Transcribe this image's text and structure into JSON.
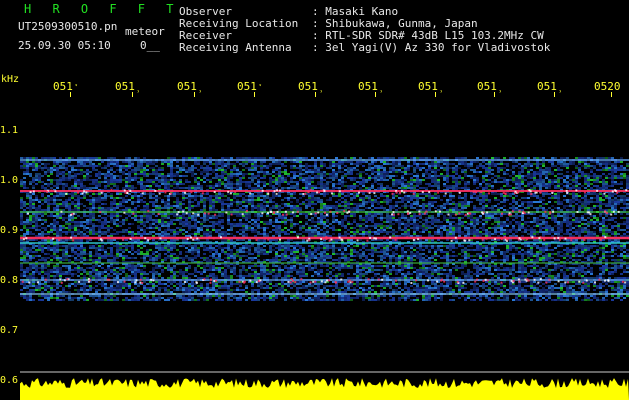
{
  "header": {
    "title": "H R O F F T",
    "filename": "UT2509300510.pn",
    "filename_suffix": "meteor",
    "timestamp": "25.09.30 05:10",
    "status": "0__",
    "info_labels": [
      "Observer",
      "Receiving Location",
      "Receiver",
      "Receiving Antenna"
    ],
    "info_values": [
      ": Masaki Kano",
      ": Shibukawa, Gunma, Japan",
      ": RTL-SDR SDR# 43dB L15 103.2MHz CW",
      ": 3el Yagi(V) Az 330 for Vladivostok"
    ]
  },
  "axis": {
    "y_unit": "kHz",
    "y_ticks": [
      "1.1",
      "1.0",
      "0.9",
      "0.8",
      "0.7",
      "0.6"
    ],
    "x_ticks": [
      "051",
      "051",
      "051",
      "051",
      "051",
      "051",
      "051",
      "051",
      "051",
      "0520"
    ],
    "x_tick_suffixes": [
      "ˑ",
      "̹",
      "̹",
      "ˑ",
      "̹",
      "̹",
      "̹",
      "̹",
      "̹",
      ""
    ]
  },
  "colors": {
    "background": "#000000",
    "header_text": "#e8e8e8",
    "title": "#22e022",
    "axis": "#ffff30",
    "meteor_line": "#ff3060",
    "signal_strong": "#20c030",
    "signal_mid": "#2a7ad8",
    "signal_low": "#1a3aa0",
    "level_bar": "#ffff00"
  }
}
